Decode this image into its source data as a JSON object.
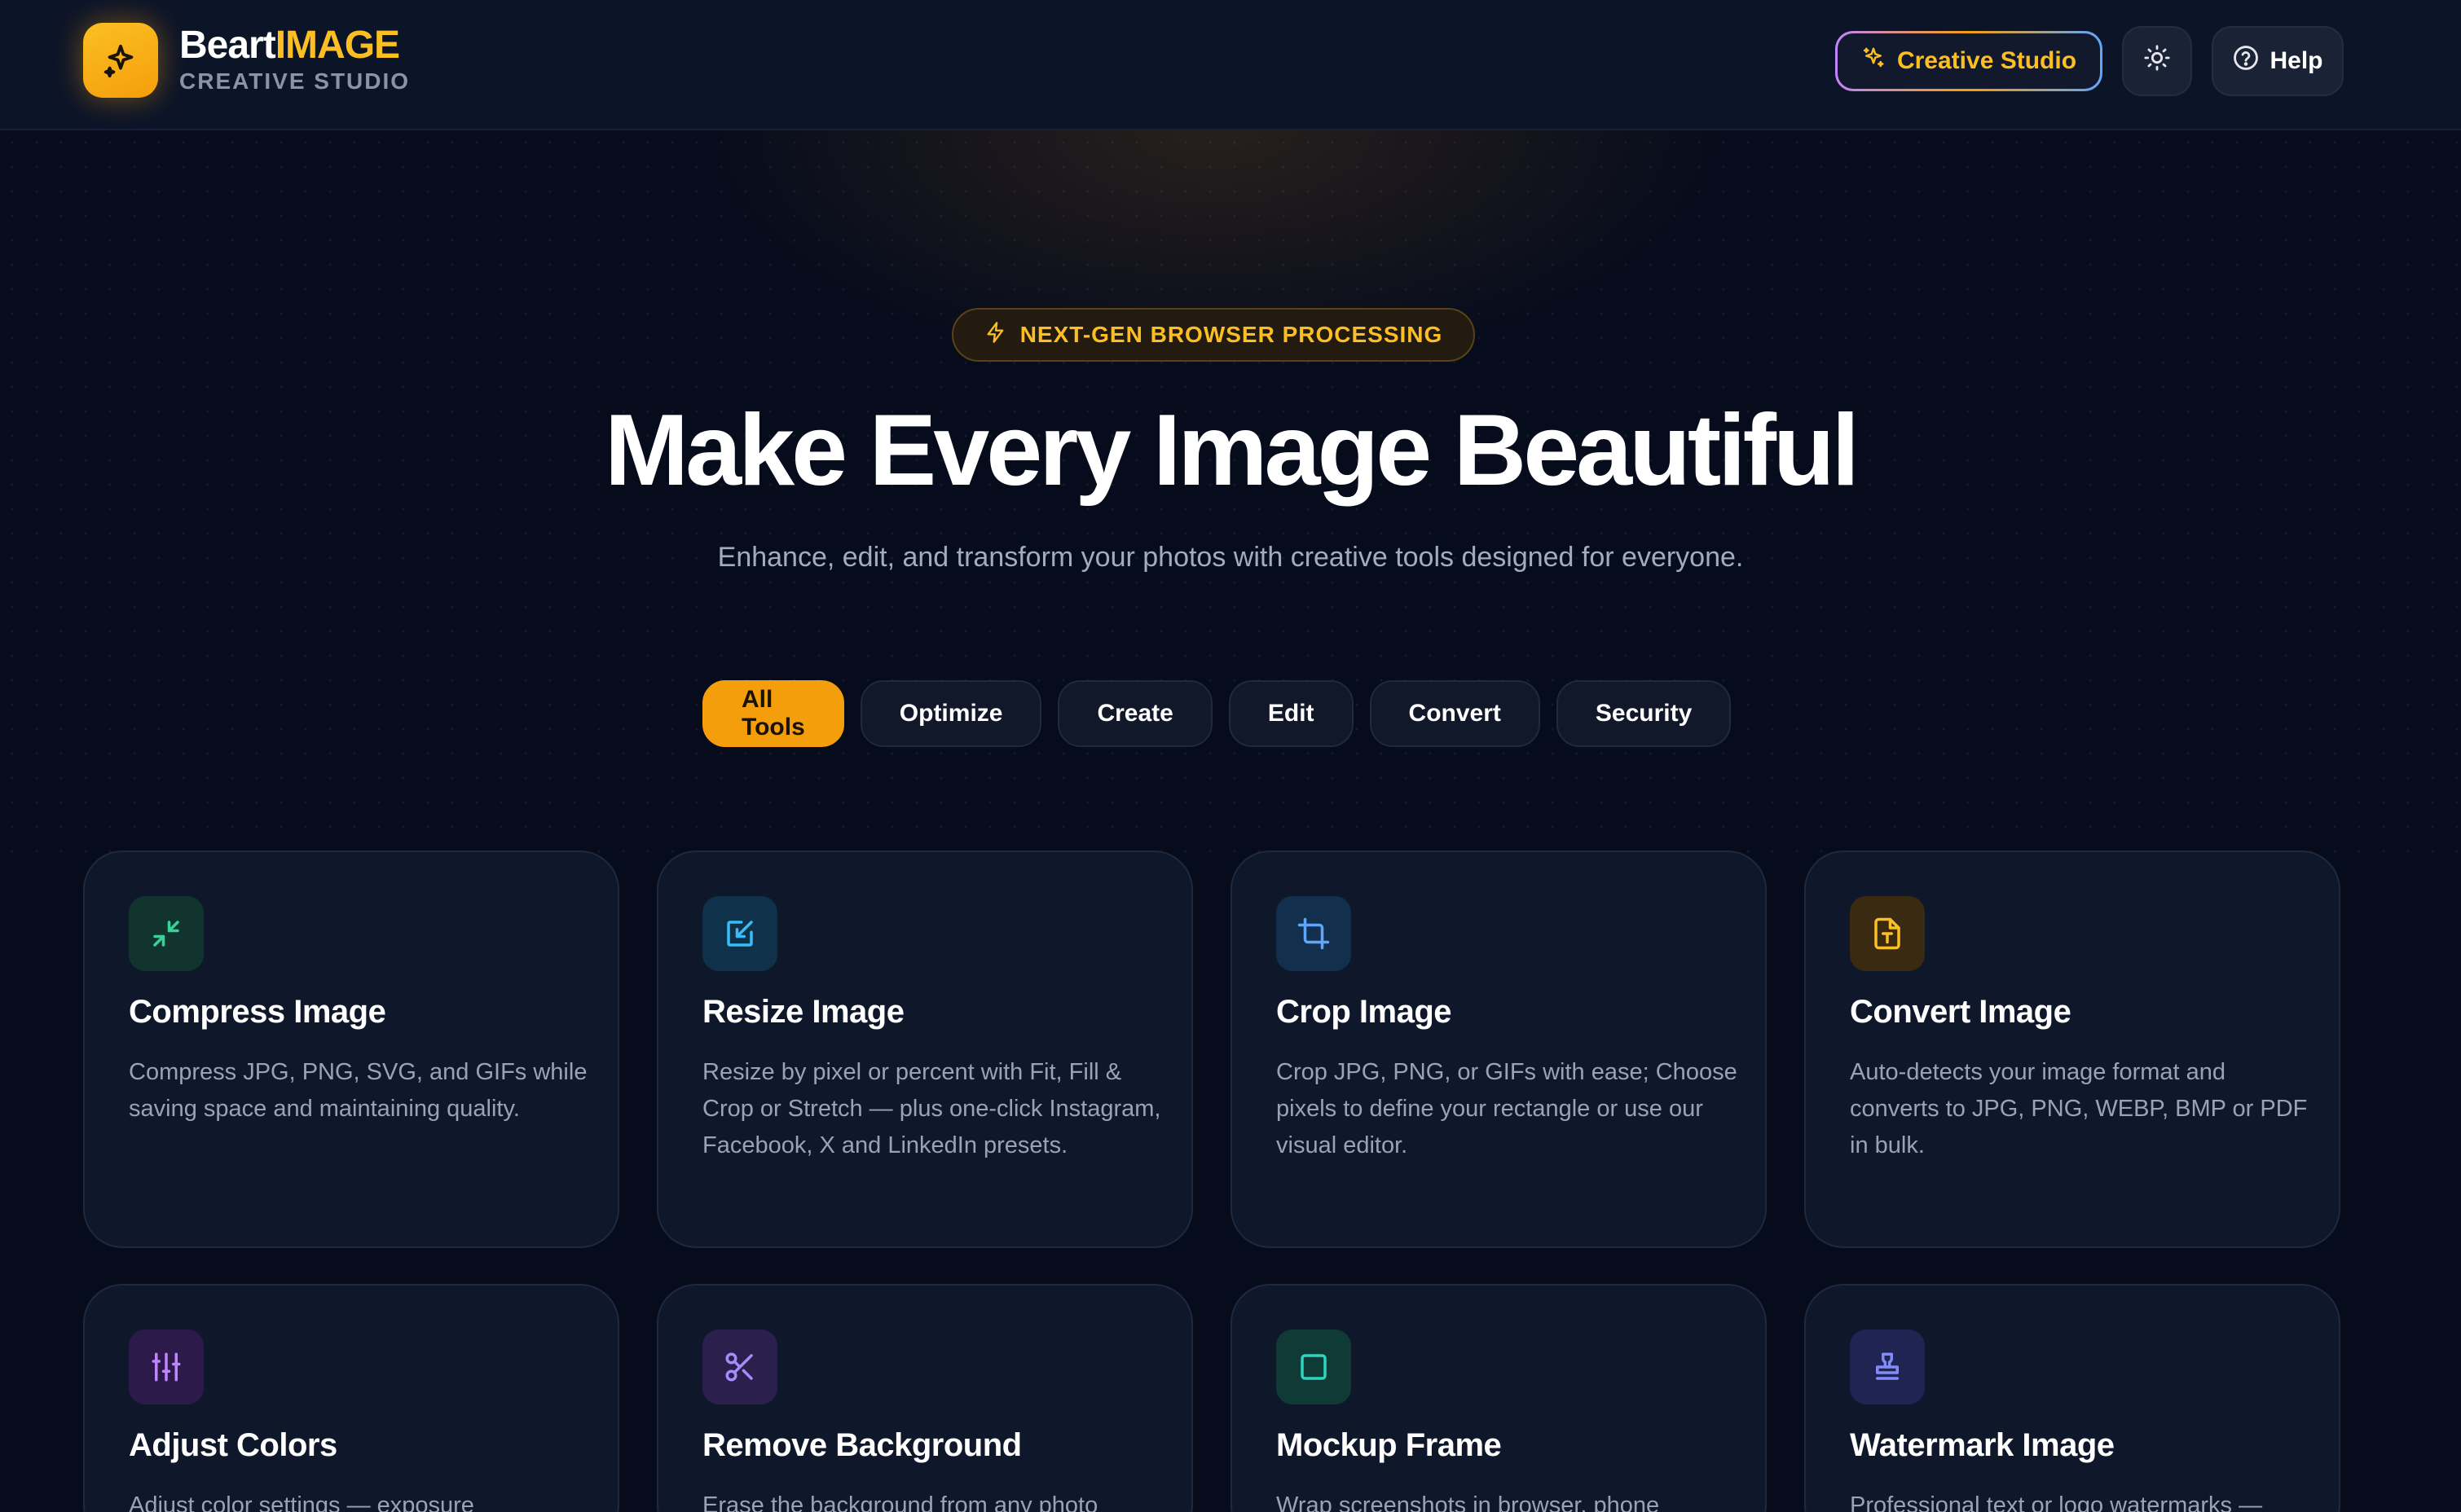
{
  "brand": {
    "name_part1": "Beart",
    "name_part2": "IMAGE",
    "subtitle": "CREATIVE STUDIO",
    "icon": "sparkles-icon"
  },
  "header": {
    "creative_studio_label": "Creative Studio",
    "theme_icon": "sun-icon",
    "help_label": "Help",
    "help_icon": "help-circle-icon"
  },
  "hero": {
    "badge_label": "NEXT-GEN BROWSER PROCESSING",
    "badge_icon": "lightning-icon",
    "title": "Make Every Image Beautiful",
    "subtitle": "Enhance, edit, and transform your photos with creative tools designed for everyone."
  },
  "filters": [
    {
      "label": "All Tools",
      "active": true
    },
    {
      "label": "Optimize",
      "active": false
    },
    {
      "label": "Create",
      "active": false
    },
    {
      "label": "Edit",
      "active": false
    },
    {
      "label": "Convert",
      "active": false
    },
    {
      "label": "Security",
      "active": false
    }
  ],
  "tools": [
    {
      "title": "Compress Image",
      "description": "Compress JPG, PNG, SVG, and GIFs while saving space and maintaining quality.",
      "icon": "minimize-arrows-icon",
      "color": "#34d399"
    },
    {
      "title": "Resize Image",
      "description": "Resize by pixel or percent with Fit, Fill & Crop or Stretch — plus one-click Instagram, Facebook, X and LinkedIn presets.",
      "icon": "resize-icon",
      "color": "#38bdf8"
    },
    {
      "title": "Crop Image",
      "description": "Crop JPG, PNG, or GIFs with ease; Choose pixels to define your rectangle or use our visual editor.",
      "icon": "crop-icon",
      "color": "#60a5fa"
    },
    {
      "title": "Convert Image",
      "description": "Auto-detects your image format and converts to JPG, PNG, WEBP, BMP or PDF in bulk.",
      "icon": "file-convert-icon",
      "color": "#fbbf24"
    },
    {
      "title": "Adjust Colors",
      "description": "Adjust color settings — exposure",
      "icon": "sliders-icon",
      "color": "#c084fc"
    },
    {
      "title": "Remove Background",
      "description": "Erase the background from any photo",
      "icon": "scissors-icon",
      "color": "#a78bfa"
    },
    {
      "title": "Mockup Frame",
      "description": "Wrap screenshots in browser, phone",
      "icon": "frame-icon",
      "color": "#2dd4bf"
    },
    {
      "title": "Watermark Image",
      "description": "Professional text or logo watermarks —",
      "icon": "stamp-icon",
      "color": "#818cf8"
    }
  ]
}
